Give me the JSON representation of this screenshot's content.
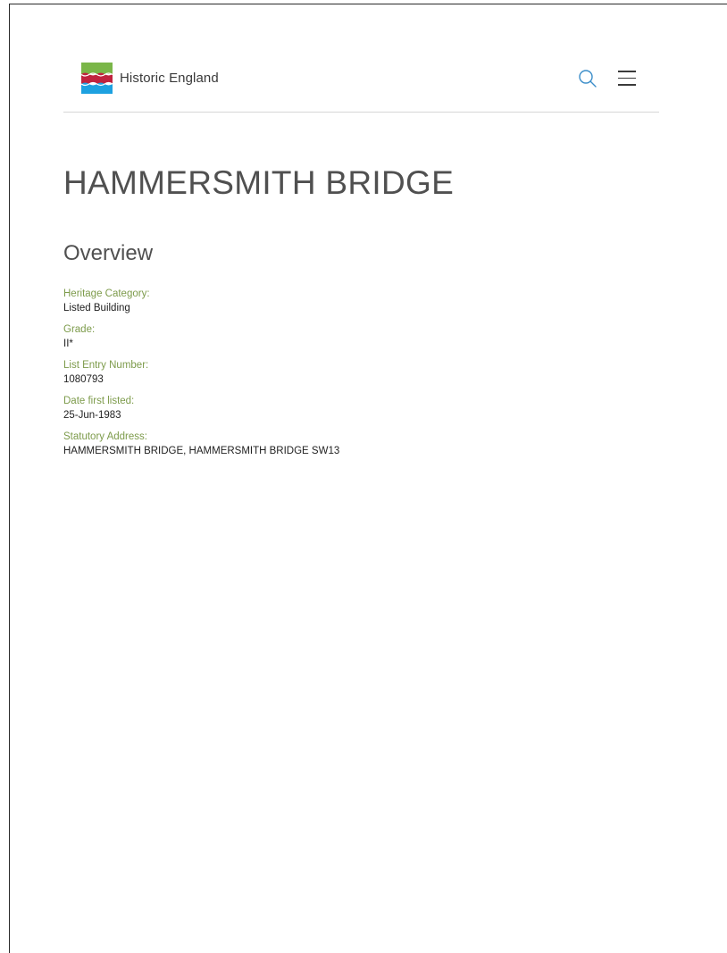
{
  "header": {
    "logo_text": "Historic England",
    "search_label": "Search",
    "menu_label": "Menu",
    "colors": {
      "logo_green": "#7ab648",
      "logo_red": "#c0233e",
      "logo_blue": "#1da1e0",
      "search_icon": "#3a8dc9"
    }
  },
  "page": {
    "title": "HAMMERSMITH BRIDGE",
    "section_heading": "Overview"
  },
  "details": [
    {
      "label": "Heritage Category:",
      "value": "Listed Building"
    },
    {
      "label": "Grade:",
      "value": "II*"
    },
    {
      "label": "List Entry Number:",
      "value": "1080793"
    },
    {
      "label": "Date first listed:",
      "value": "25-Jun-1983"
    },
    {
      "label": "Statutory Address:",
      "value": "HAMMERSMITH BRIDGE, HAMMERSMITH BRIDGE SW13"
    }
  ]
}
